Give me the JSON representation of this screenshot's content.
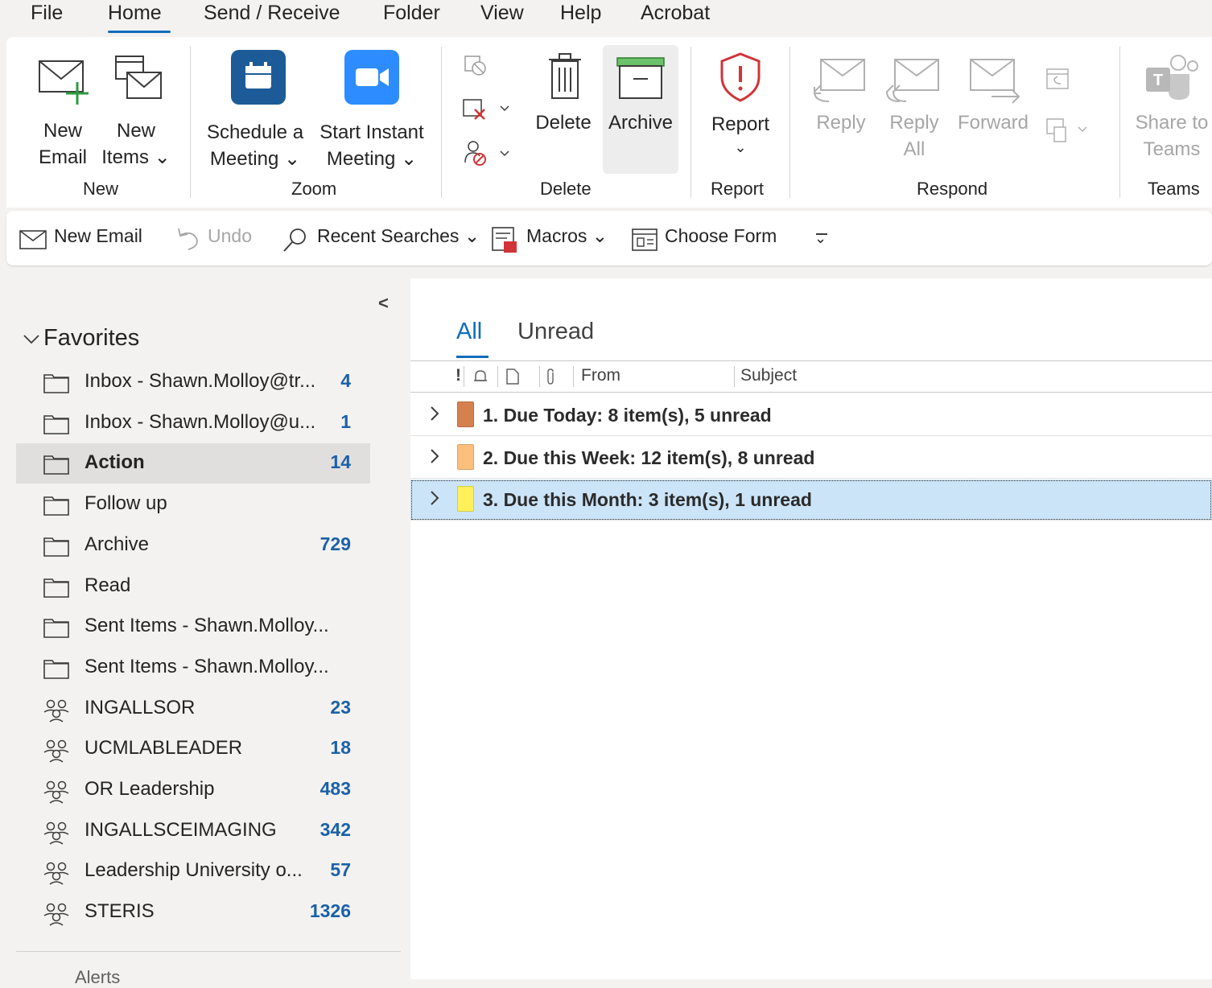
{
  "menu_tabs": [
    "File",
    "Home",
    "Send / Receive",
    "Folder",
    "View",
    "Help",
    "Acrobat"
  ],
  "ribbon": {
    "new": {
      "new_email": [
        "New",
        "Email"
      ],
      "new_items": [
        "New",
        "Items ⌄"
      ],
      "group": "New"
    },
    "zoom": {
      "schedule": [
        "Schedule a",
        "Meeting ⌄"
      ],
      "start_instant": [
        "Start Instant",
        "Meeting ⌄"
      ],
      "group": "Zoom"
    },
    "delete": {
      "delete": "Delete",
      "archive": "Archive",
      "group": "Delete"
    },
    "report": {
      "report": "Report",
      "caret": "⌄",
      "group": "Report"
    },
    "respond": {
      "reply": "Reply",
      "reply_all": [
        "Reply",
        "All"
      ],
      "forward": "Forward",
      "group": "Respond"
    },
    "teams": {
      "share": [
        "Share to",
        "Teams"
      ],
      "group": "Teams"
    }
  },
  "qat": {
    "new_email": "New Email",
    "undo": "Undo",
    "recent_searches": "Recent Searches ⌄",
    "macros": "Macros ⌄",
    "choose_form": "Choose Form",
    "overflow": "⌄"
  },
  "nav": {
    "collapse": "<",
    "favorites_title": "Favorites",
    "items": [
      {
        "label": "Inbox - Shawn.Molloy@tr...",
        "count": "4",
        "type": "folder"
      },
      {
        "label": "Inbox - Shawn.Molloy@u...",
        "count": "1",
        "type": "folder"
      },
      {
        "label": "Action",
        "count": "14",
        "type": "folder"
      },
      {
        "label": "Follow up",
        "count": "",
        "type": "folder"
      },
      {
        "label": "Archive",
        "count": "729",
        "type": "folder"
      },
      {
        "label": "Read",
        "count": "",
        "type": "folder"
      },
      {
        "label": "Sent Items - Shawn.Molloy...",
        "count": "",
        "type": "folder"
      },
      {
        "label": "Sent Items - Shawn.Molloy...",
        "count": "",
        "type": "folder"
      },
      {
        "label": "INGALLSOR",
        "count": "23",
        "type": "group"
      },
      {
        "label": "UCMLABLEADER",
        "count": "18",
        "type": "group"
      },
      {
        "label": "OR Leadership",
        "count": "483",
        "type": "group"
      },
      {
        "label": "INGALLSCEIMAGING",
        "count": "342",
        "type": "group"
      },
      {
        "label": "Leadership University o...",
        "count": "57",
        "type": "group"
      },
      {
        "label": "STERIS",
        "count": "1326",
        "type": "group"
      }
    ],
    "selected_index": 2,
    "bottom_label": "Alerts"
  },
  "list": {
    "tabs": [
      "All",
      "Unread"
    ],
    "headers": {
      "importance": "!",
      "from": "From",
      "subject": "Subject"
    },
    "groups": [
      {
        "text": "1. Due Today: 8 item(s), 5 unread",
        "color": "#d7804f"
      },
      {
        "text": "2. Due this Week: 12 item(s), 8 unread",
        "color": "#fcbf7c"
      },
      {
        "text": "3. Due this Month: 3 item(s), 1 unread",
        "color": "#fff05a"
      }
    ]
  }
}
